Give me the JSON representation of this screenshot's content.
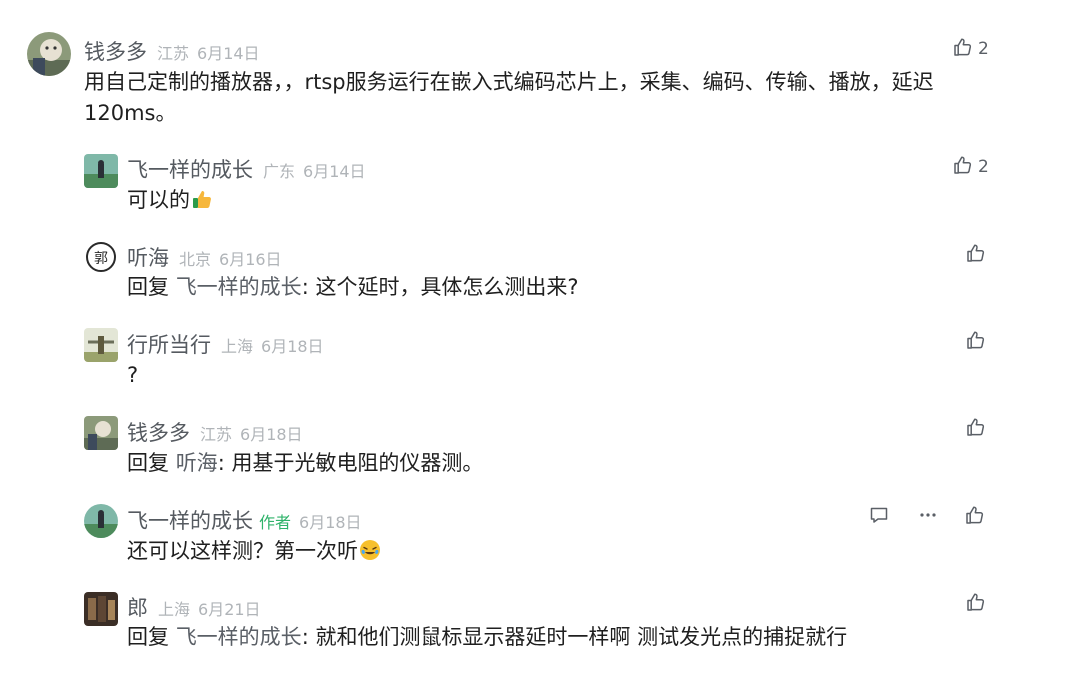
{
  "comments": [
    {
      "author": "钱多多",
      "region": "江苏",
      "date": "6月14日",
      "text": "用自己定制的播放器，，rtsp服务运行在嵌入式编码芯片上，采集、编码、传输、播放，延迟",
      "text_line2": "120ms。",
      "likes": "2"
    },
    {
      "author": "飞一样的成长",
      "region": "广东",
      "date": "6月14日",
      "text": "可以的",
      "emoji": "thumbs-up-emoji",
      "likes": "2"
    },
    {
      "author": "听海",
      "region": "北京",
      "date": "6月16日",
      "reply_prefix": "回复 ",
      "reply_to": "飞一样的成长",
      "text": ": 这个延时，具体怎么测出来?"
    },
    {
      "author": "行所当行",
      "region": "上海",
      "date": "6月18日",
      "text": "?"
    },
    {
      "author": "钱多多",
      "region": "江苏",
      "date": "6月18日",
      "reply_prefix": "回复 ",
      "reply_to": "听海",
      "text": ": 用基于光敏电阻的仪器测。"
    },
    {
      "author": "飞一样的成长",
      "author_tag": "作者",
      "date": "6月18日",
      "text": "还可以这样测？第一次听",
      "emoji": "laughing-crying-emoji"
    },
    {
      "author": "郎",
      "region": "上海",
      "date": "6月21日",
      "reply_prefix": "回复 ",
      "reply_to": "飞一样的成长",
      "text": ": 就和他们测鼠标显示器延时一样啊 测试发光点的捕捉就行"
    }
  ],
  "icons": {
    "like": "thumbs-up-outline-icon",
    "comment": "comment-bubble-icon",
    "more": "more-dots-icon"
  },
  "colors": {
    "author": "#555a60",
    "meta": "#b0b4b8",
    "author_tag": "#2fb36a",
    "text": "#1f1f1f",
    "icon": "#5a5f66"
  }
}
